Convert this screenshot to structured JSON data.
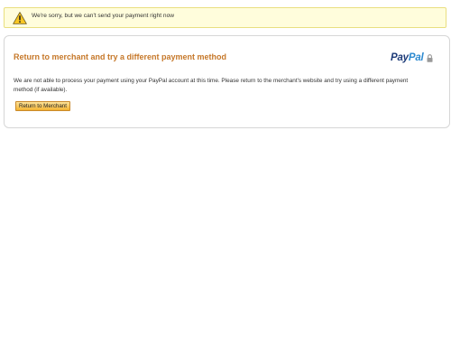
{
  "alert": {
    "icon": "warning-icon",
    "message": "We're sorry, but we can't send your payment right now"
  },
  "panel": {
    "title": "Return to merchant and try a different payment method",
    "logo": {
      "text_part1": "Pay",
      "text_part2": "Pal",
      "lock_icon": "lock-icon"
    },
    "body_text": "We are not able to process your payment using your PayPal account at this time. Please return to the merchant's website and try using a different payment method (if available).",
    "button_label": "Return to Merchant"
  },
  "colors": {
    "title": "#c6782a",
    "alert_background": "#fffddc",
    "alert_border": "#e9df80",
    "logo_dark": "#1e3b78",
    "logo_light": "#2d8ad0",
    "button_top": "#fde39a",
    "button_bottom": "#f3b432"
  }
}
